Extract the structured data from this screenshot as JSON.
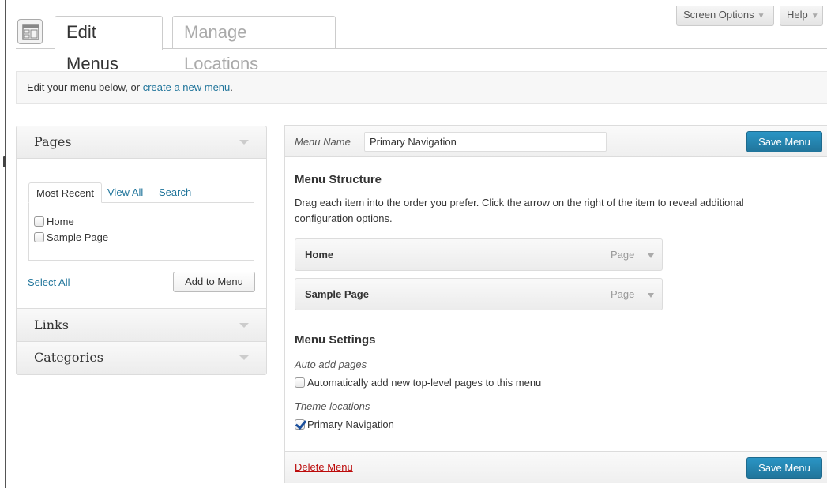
{
  "header": {
    "tabs": [
      {
        "label": "Edit Menus",
        "active": true
      },
      {
        "label": "Manage Locations",
        "active": false
      }
    ],
    "screen_options_label": "Screen Options",
    "help_label": "Help",
    "dropdown_icon": "triangle-down-icon",
    "page_icon": "menus-page-icon"
  },
  "notice": {
    "text": "Edit your menu below, or ",
    "link": "create a new menu",
    "suffix": "."
  },
  "sidebar": {
    "sections": [
      {
        "title": "Pages",
        "expanded": true
      },
      {
        "title": "Links",
        "expanded": false
      },
      {
        "title": "Categories",
        "expanded": false
      }
    ],
    "pages": {
      "tabs": [
        "Most Recent",
        "View All",
        "Search"
      ],
      "items": [
        {
          "label": "Home",
          "checked": false
        },
        {
          "label": "Sample Page",
          "checked": false
        }
      ],
      "select_all": "Select All",
      "add_button": "Add to Menu"
    }
  },
  "main": {
    "menu_name_label": "Menu Name",
    "menu_name_value": "Primary Navigation",
    "save_label": "Save Menu",
    "structure_title": "Menu Structure",
    "structure_desc": "Drag each item into the order you prefer. Click the arrow on the right of the item to reveal additional configuration options.",
    "items": [
      {
        "title": "Home",
        "type": "Page"
      },
      {
        "title": "Sample Page",
        "type": "Page"
      }
    ],
    "settings_title": "Menu Settings",
    "auto_add_label": "Auto add pages",
    "auto_add_option": {
      "label": "Automatically add new top-level pages to this menu",
      "checked": false
    },
    "theme_locations_label": "Theme locations",
    "theme_location_option": {
      "label": "Primary Navigation",
      "checked": true
    },
    "delete_label": "Delete Menu"
  },
  "colors": {
    "link": "#21759b",
    "primary_button": "#21759b",
    "delete": "#bc0b0b"
  }
}
